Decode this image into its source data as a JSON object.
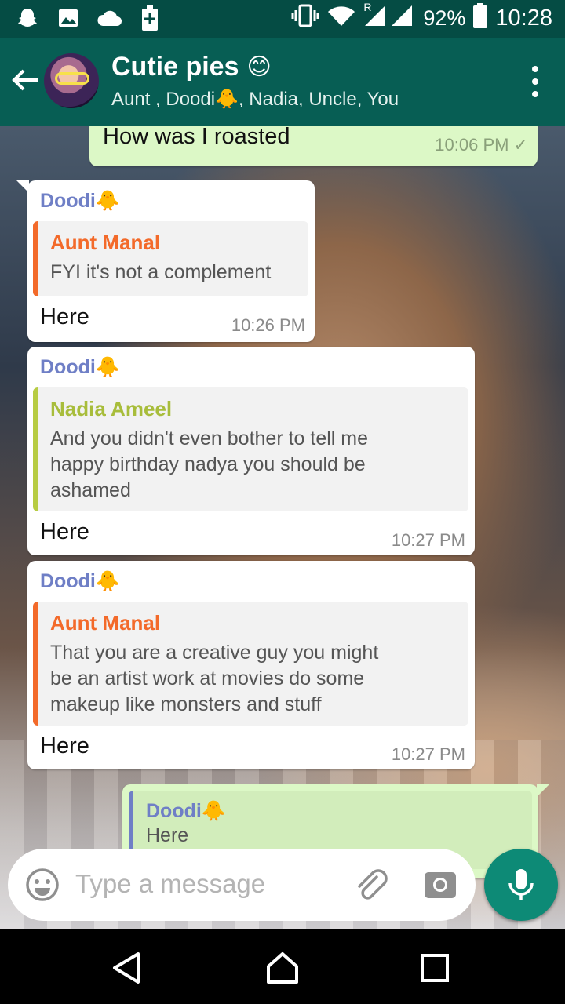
{
  "status_bar": {
    "battery": "92%",
    "time": "10:28",
    "roaming": "R"
  },
  "header": {
    "title": "Cutie pies",
    "title_emoji": "😊",
    "subtitle": "Aunt , Doodi🐥, Nadia, Uncle, You"
  },
  "messages": [
    {
      "direction": "outgoing",
      "text": "How was I roasted",
      "time": "10:06 PM ✓"
    },
    {
      "direction": "incoming",
      "sender": "Doodi🐥",
      "quote_name": "Aunt Manal",
      "quote_text": "FYI it's not a complement",
      "text": "Here",
      "time": "10:26 PM"
    },
    {
      "direction": "incoming",
      "sender": "Doodi🐥",
      "quote_name": "Nadia Ameel",
      "quote_lines": [
        "And you didn't even bother to tell me",
        "happy birthday nadya you should be",
        "ashamed"
      ],
      "text": "Here",
      "time": "10:27 PM"
    },
    {
      "direction": "incoming",
      "sender": "Doodi🐥",
      "quote_name": "Aunt Manal",
      "quote_lines": [
        "That you are a creative guy you might",
        "be an artist work at movies do some",
        "makeup like monsters and stuff"
      ],
      "text": "Here",
      "time": "10:27 PM"
    },
    {
      "direction": "outgoing",
      "quote_name": "Doodi🐥",
      "quote_text": "Here"
    }
  ],
  "composer": {
    "placeholder": "Type a message"
  },
  "icons": {
    "status_left": [
      "snapchat-icon",
      "image-icon",
      "cloud-icon",
      "battery-plus-icon"
    ],
    "status_right": [
      "vibrate-icon",
      "wifi-icon",
      "signal-icon"
    ],
    "appbar": [
      "back-arrow-icon",
      "more-vert-icon"
    ],
    "composer": [
      "emoji-icon",
      "attach-icon",
      "camera-icon",
      "mic-icon"
    ],
    "navbar": [
      "nav-back-icon",
      "nav-home-icon",
      "nav-recents-icon"
    ]
  },
  "colors": {
    "status_bar": "#054c44",
    "app_bar": "#075e54",
    "incoming_bubble": "#ffffff",
    "outgoing_bubble": "#dcf8c6",
    "sender_name": "#6f7fc6",
    "quote_aunt": "#f36a2a",
    "quote_nadia": "#b7cc43",
    "mic_button": "#0d8a76"
  }
}
